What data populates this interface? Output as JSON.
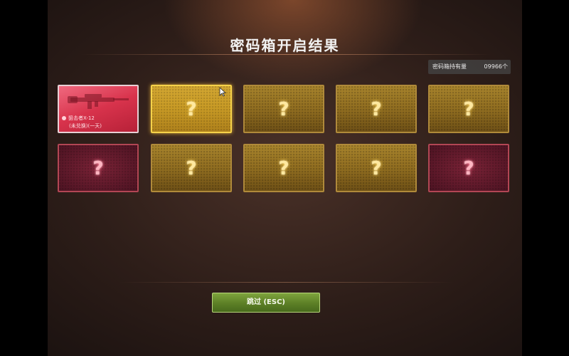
{
  "title": "密码箱开启结果",
  "holdings": {
    "label": "密码箱持有量",
    "count": "09966个"
  },
  "cards": [
    {
      "type": "revealed",
      "name": "狙击者X-12",
      "sub": "(未兑换)(一天)",
      "icon": "rifle-icon"
    },
    {
      "type": "selected",
      "mark": "?"
    },
    {
      "type": "gold",
      "mark": "?"
    },
    {
      "type": "gold",
      "mark": "?"
    },
    {
      "type": "gold",
      "mark": "?"
    },
    {
      "type": "red",
      "mark": "?"
    },
    {
      "type": "gold",
      "mark": "?"
    },
    {
      "type": "gold",
      "mark": "?"
    },
    {
      "type": "gold",
      "mark": "?"
    },
    {
      "type": "red",
      "mark": "?"
    }
  ],
  "skip_button": {
    "label": "跳过 (ESC)"
  },
  "colors": {
    "gold_card": "#9a7725",
    "red_card": "#5e1a2b",
    "revealed_card": "#e04860",
    "skip_button": "#5f8429"
  }
}
